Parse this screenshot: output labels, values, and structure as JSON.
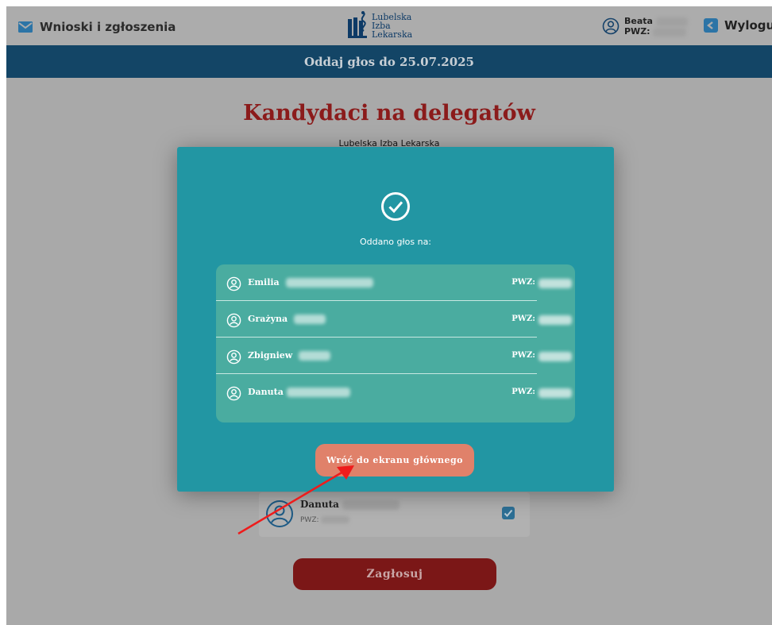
{
  "header": {
    "nav_label": "Wnioski i zgłoszenia",
    "logo_lines": [
      "Lubelska",
      "Izba",
      "Lekarska"
    ],
    "user_first_name": "Beata",
    "user_pwz_label": "PWZ:",
    "logout_label": "Wyloguj"
  },
  "banner": {
    "text": "Oddaj głos do 25.07.2025"
  },
  "main": {
    "title": "Kandydaci na delegatów",
    "subtitle": "Lubelska Izba Lekarska",
    "background_card": {
      "first_name": "Danuta",
      "pwz_label": "PWZ:"
    },
    "vote_button": "Zagłosuj"
  },
  "modal": {
    "message": "Oddano głos na:",
    "candidates": [
      {
        "first_name": "Emilia",
        "pwz_label": "PWZ:"
      },
      {
        "first_name": "Grażyna",
        "pwz_label": "PWZ:"
      },
      {
        "first_name": "Zbigniew",
        "pwz_label": "PWZ:"
      },
      {
        "first_name": "Danuta",
        "pwz_label": "PWZ:"
      }
    ],
    "back_button": "Wróć do ekranu głównego"
  },
  "colors": {
    "modal_bg": "#2296a3",
    "list_bg": "#4aaca0",
    "back_button": "#e0816a",
    "title": "#8b1b1b",
    "banner": "#134566",
    "arrow": "#ee1c1c"
  }
}
